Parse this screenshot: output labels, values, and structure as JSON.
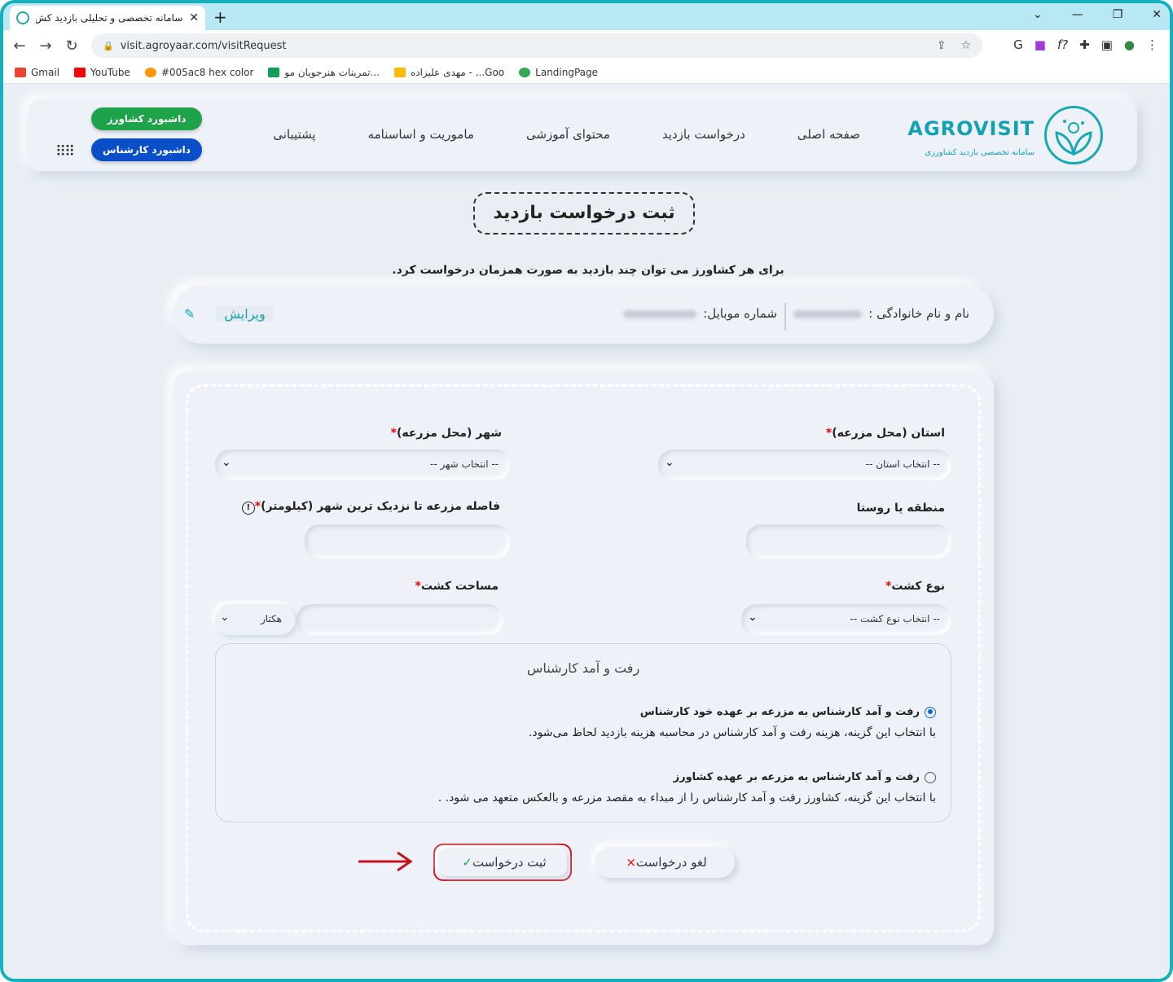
{
  "browser": {
    "tab_title": "سامانه تخصصی و تحلیلی بازدید کش",
    "new_tab": "+",
    "url": "visit.agroyaar.com/visitRequest",
    "bookmarks": [
      {
        "label": "Gmail",
        "color": "#ea4335"
      },
      {
        "label": "YouTube",
        "color": "#ff0000"
      },
      {
        "label": "#005ac8 hex color",
        "color": "#ff9800"
      },
      {
        "label": "تمرینات هنرجویان مو...",
        "color": "#0f9d58"
      },
      {
        "label": "مهدی علیزاده - ...Goo",
        "color": "#fbbc04"
      },
      {
        "label": "LandingPage",
        "color": "#34a853"
      }
    ]
  },
  "header": {
    "logo_title": "AGROVISIT",
    "logo_subtitle": "سامانه تخصصی بازدید کشاورزی",
    "menu": [
      "صفحه اصلی",
      "درخواست بازدید",
      "محتوای آموزشی",
      "ماموریت و اساسنامه",
      "پشتیبانی"
    ],
    "farmer_dashboard": "داشبورد کشاورز",
    "expert_dashboard": "داشبورد کارشناس"
  },
  "page": {
    "title": "ثبت درخواست بازدید",
    "subtitle": "برای هر کشاورز می توان چند بازدید به صورت همزمان درخواست کرد."
  },
  "user": {
    "name_label": "نام و نام خانوادگی :",
    "mobile_label": "شماره موبایل:",
    "edit_label": "ویرایش"
  },
  "form": {
    "province_label": "استان (محل مزرعه)",
    "province_placeholder": "-- انتخاب استان --",
    "city_label": "شهر (محل مزرعه)",
    "city_placeholder": "-- انتخاب شهر --",
    "region_label": "منطقه یا روستا",
    "distance_label": "فاصله مزرعه تا نزدیک ترین شهر (کیلومتر)",
    "crop_type_label": "نوع کشت",
    "crop_type_placeholder": "-- انتخاب نوع کشت --",
    "area_label": "مساحت کشت",
    "area_unit": "هکتار",
    "required_mark": "*",
    "travel": {
      "title": "رفت و آمد کارشناس",
      "option1_title": "رفت و آمد کارشناس به مزرعه بر عهده خود کارشناس",
      "option1_desc": "با انتخاب این گزینه، هزینه رفت و آمد کارشناس در محاسبه هزینه بازدید لحاظ می‌شود.",
      "option2_title": "رفت و آمد کارشناس به مزرعه بر عهده کشاورز",
      "option2_desc": "با انتخاب این گزینه، کشاورز رفت و آمد کارشناس را از مبداء به مقصد مزرعه و بالعکس متعهد می شود. ."
    },
    "submit_label": "ثبت درخواست",
    "cancel_label": "لغو درخواست"
  }
}
